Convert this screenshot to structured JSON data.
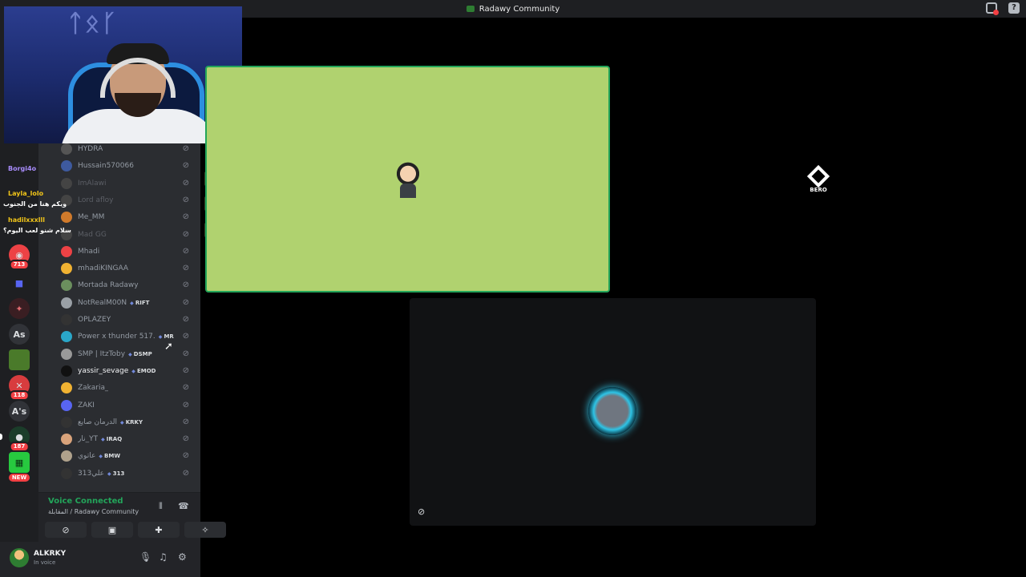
{
  "window": {
    "title": "Radawy Community"
  },
  "members": [
    {
      "name": "HYDRA",
      "tag": ""
    },
    {
      "name": "Hussain570066",
      "tag": ""
    },
    {
      "name": "ImAlawi",
      "tag": ""
    },
    {
      "name": "Lord afloy",
      "tag": ""
    },
    {
      "name": "Me_MM",
      "tag": ""
    },
    {
      "name": "Mad GG",
      "tag": ""
    },
    {
      "name": "Mhadi",
      "tag": ""
    },
    {
      "name": "mhadiKINGAA",
      "tag": ""
    },
    {
      "name": "Mortada Radawy",
      "tag": ""
    },
    {
      "name": "NotRealM00N",
      "tag": "RIFT"
    },
    {
      "name": "OPLAZEY",
      "tag": ""
    },
    {
      "name": "Power x thunder 517.",
      "tag": "MR"
    },
    {
      "name": "SMP | ItzToby",
      "tag": "DSMP"
    },
    {
      "name": "yassir_sevage",
      "tag": "EMOD"
    },
    {
      "name": "Zakaria_",
      "tag": ""
    },
    {
      "name": "ZAKI",
      "tag": ""
    },
    {
      "name": "الدرمان صايع",
      "tag": "KRKY"
    },
    {
      "name": "نار_YT",
      "tag": "IRAQ"
    },
    {
      "name": "عاتوي",
      "tag": "BMW"
    },
    {
      "name": "علي313",
      "tag": "313"
    }
  ],
  "rail": {
    "badges": [
      "713",
      "118",
      "187"
    ],
    "labels": [
      "As",
      "A's"
    ],
    "new_label": "NEW"
  },
  "chat": [
    {
      "text": "Borgi4o"
    },
    {
      "text": "Layla_lolo"
    },
    {
      "text": "ويكم هنا من الجنوب"
    },
    {
      "text": "hadilxxxlll"
    },
    {
      "text": "سلام شنو لعب اليوم؟"
    }
  ],
  "voice": {
    "status": "Voice Connected",
    "channel": "المقابلة / Radawy Community"
  },
  "user": {
    "name": "ALKRKY",
    "status": "In voice"
  },
  "stage": {
    "logo_text": "BERO"
  },
  "colors": {
    "voice_green": "#23a55a",
    "tile_green": "#b0d26f",
    "notification_red": "#f23f43"
  }
}
